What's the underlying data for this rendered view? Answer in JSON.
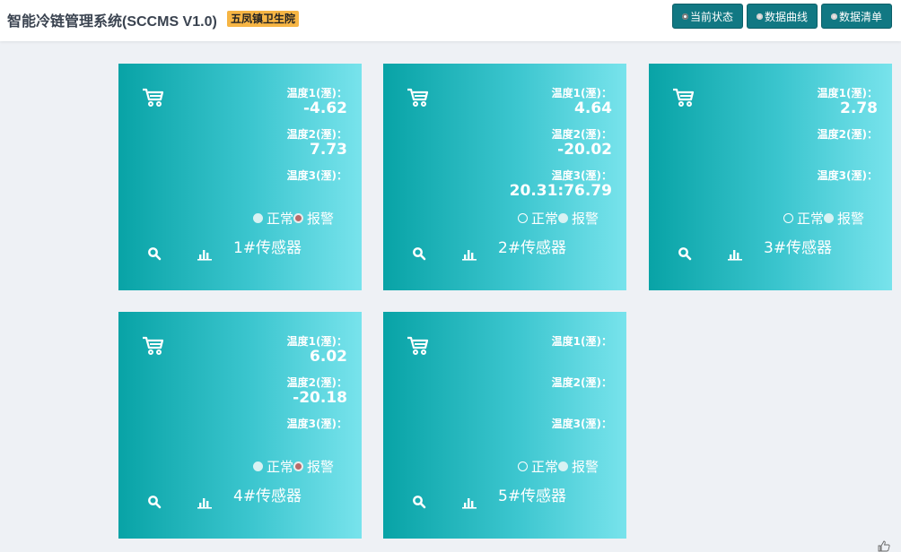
{
  "header": {
    "title": "智能冷链管理系统(SCCMS V1.0)",
    "org": "五凤镇卫生院",
    "nav": [
      {
        "label": "当前状态",
        "active": true
      },
      {
        "label": "数据曲线",
        "active": false
      },
      {
        "label": "数据清单",
        "active": false
      }
    ]
  },
  "labels": {
    "temp1": "温度1(溼)：",
    "temp2": "温度2(溼)：",
    "temp3": "温度3(溼)：",
    "normal": "正常",
    "alarm": "报警"
  },
  "sensors": [
    {
      "name": "1#传感器",
      "t1": "-4.62",
      "t2": "7.73",
      "t3": "",
      "state": "alarm"
    },
    {
      "name": "2#传感器",
      "t1": "4.64",
      "t2": "-20.02",
      "t3": "20.31:76.79",
      "state": "normal"
    },
    {
      "name": "3#传感器",
      "t1": "2.78",
      "t2": "",
      "t3": "",
      "state": "normal"
    },
    {
      "name": "4#传感器",
      "t1": "6.02",
      "t2": "-20.18",
      "t3": "",
      "state": "alarm"
    },
    {
      "name": "5#传感器",
      "t1": "",
      "t2": "",
      "t3": "",
      "state": "normal"
    }
  ],
  "colors": {
    "nav_bg": "#117883",
    "badge_bg": "#f6b544",
    "card_gradient_start": "#08a3a6",
    "card_gradient_end": "#78e3ec",
    "alarm_dot": "#b86a6a"
  },
  "icons": {
    "card": "cart-icon",
    "view": "search-icon",
    "stats": "bar-chart-icon"
  }
}
